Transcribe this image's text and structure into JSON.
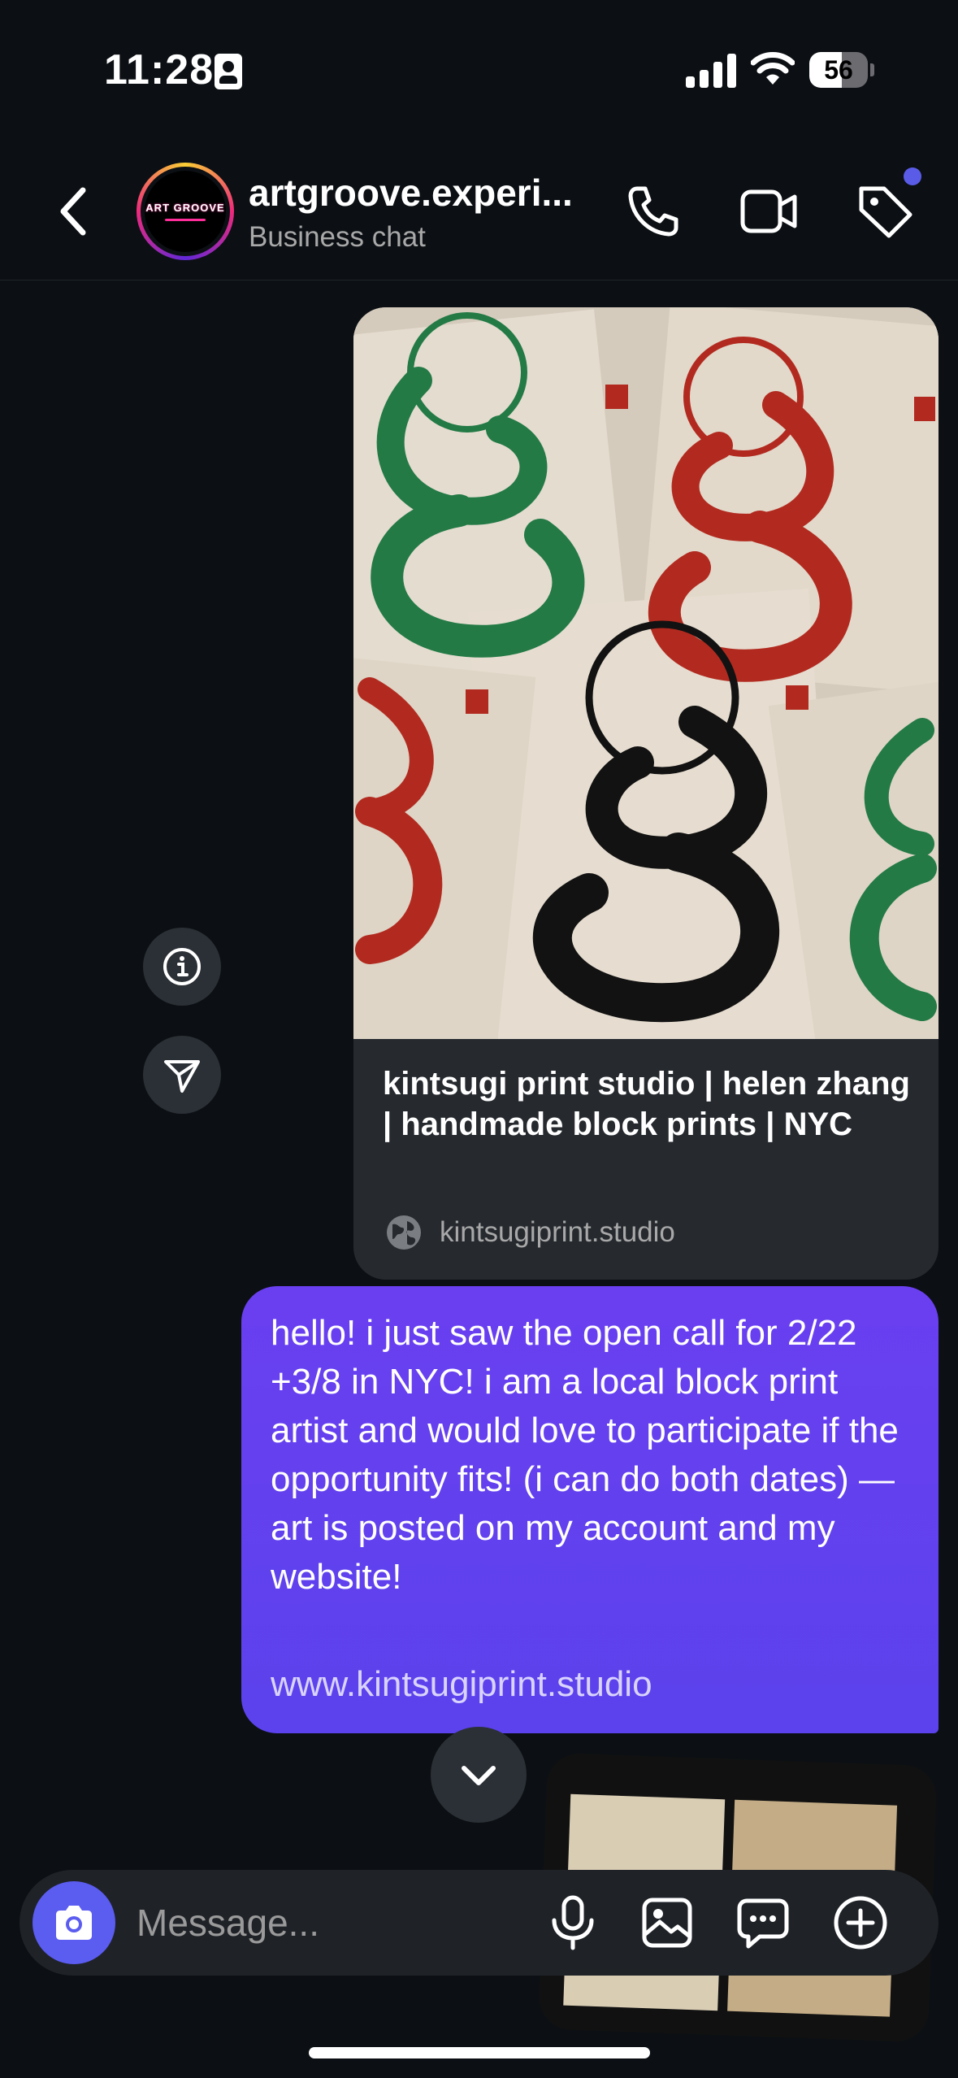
{
  "status_bar": {
    "time": "11:28",
    "battery_level": "56",
    "battery_fraction": 0.56
  },
  "header": {
    "chat_name": "artgroove.experi...",
    "chat_subtitle": "Business chat",
    "avatar_logo_text": "ART GROOVE",
    "accent_color": "#5a5ce8"
  },
  "shared_link": {
    "title": "kintsugi print studio | helen zhang | handmade block prints | NYC",
    "domain": "kintsugiprint.studio"
  },
  "message": {
    "text": "hello! i just saw the open call for 2/22 +3/8 in NYC! i am a local block print artist and would love to participate if the opportunity fits! (i can do both dates) — art is posted on my account and my website!",
    "link": "www.kintsugiprint.studio",
    "bubble_color": "#6a3ff0"
  },
  "composer": {
    "placeholder": "Message..."
  },
  "icons": {
    "back": "chevron-left-icon",
    "call": "phone-icon",
    "video": "video-camera-icon",
    "tag": "tag-icon",
    "info": "info-icon",
    "share": "send-icon",
    "scroll_down": "chevron-down-icon",
    "camera": "camera-icon",
    "mic": "microphone-icon",
    "gallery": "image-icon",
    "sticker": "chat-bubble-icon",
    "more": "plus-circle-icon"
  }
}
